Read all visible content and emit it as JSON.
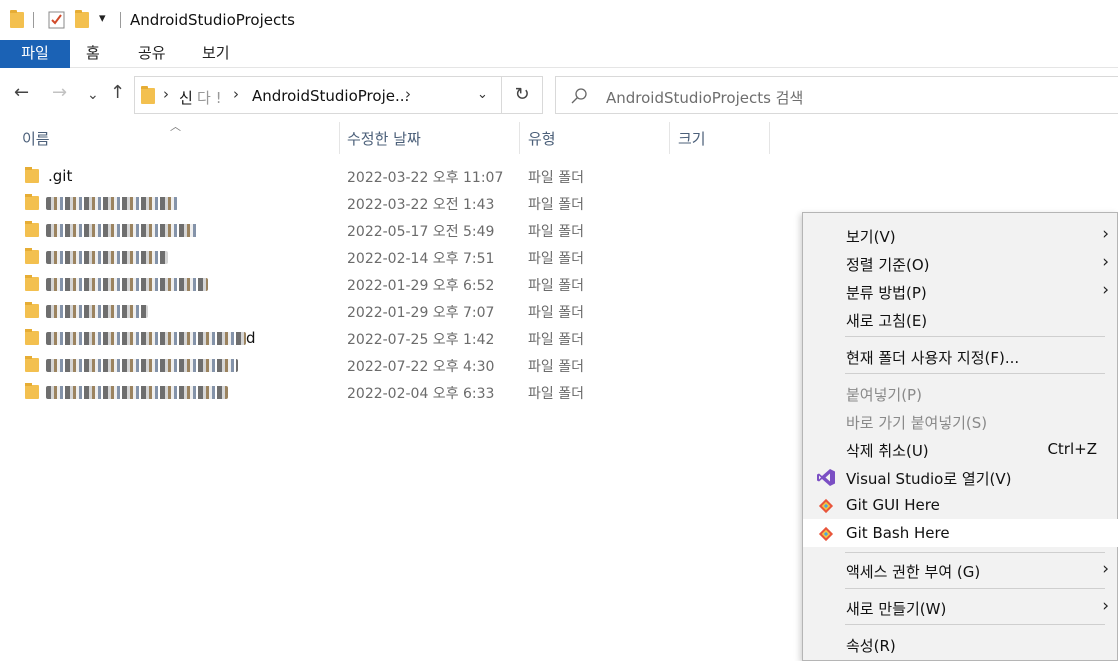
{
  "window": {
    "title": "AndroidStudioProjects",
    "quick_access_overflow": "▾"
  },
  "ribbon": {
    "tabs": [
      {
        "label": "파일",
        "active": true
      },
      {
        "label": "홈"
      },
      {
        "label": "공유"
      },
      {
        "label": "보기"
      }
    ]
  },
  "navigation": {
    "back": "←",
    "forward": "→",
    "recent": "⌄",
    "up": "↑",
    "breadcrumb": [
      "신",
      "AndroidStudioProje..."
    ],
    "breadcrumb_mid": "다 !",
    "refresh": "↻",
    "search_placeholder": "AndroidStudioProjects 검색"
  },
  "columns": {
    "name": "이름",
    "modified": "수정한 날짜",
    "type": "유형",
    "size": "크기"
  },
  "files": [
    {
      "name": ".git",
      "date": "2022-03-22 오후 11:07",
      "type": "파일 폴더",
      "blurred": false
    },
    {
      "name": "",
      "date": "2022-03-22 오전 1:43",
      "type": "파일 폴더",
      "blurred": true,
      "blur_w": 132
    },
    {
      "name": "",
      "date": "2022-05-17 오전 5:49",
      "type": "파일 폴더",
      "blurred": true,
      "blur_w": 152
    },
    {
      "name": "",
      "date": "2022-02-14 오후 7:51",
      "type": "파일 폴더",
      "blurred": true,
      "blur_w": 122
    },
    {
      "name": "",
      "date": "2022-01-29 오후 6:52",
      "type": "파일 폴더",
      "blurred": true,
      "blur_w": 162
    },
    {
      "name": "",
      "date": "2022-01-29 오후 7:07",
      "type": "파일 폴더",
      "blurred": true,
      "blur_w": 102
    },
    {
      "name": "d",
      "date": "2022-07-25 오후 1:42",
      "type": "파일 폴더",
      "blurred": true,
      "blur_w": 200
    },
    {
      "name": "",
      "date": "2022-07-22 오후 4:30",
      "type": "파일 폴더",
      "blurred": true,
      "blur_w": 192
    },
    {
      "name": "",
      "date": "2022-02-04 오후 6:33",
      "type": "파일 폴더",
      "blurred": true,
      "blur_w": 182
    }
  ],
  "context_menu": {
    "items": [
      {
        "label": "보기(V)",
        "submenu": true
      },
      {
        "label": "정렬 기준(O)",
        "submenu": true
      },
      {
        "label": "분류 방법(P)",
        "submenu": true
      },
      {
        "label": "새로 고침(E)"
      },
      {
        "label": "현재 폴더 사용자 지정(F)..."
      },
      {
        "label": "붙여넣기(P)",
        "disabled": true
      },
      {
        "label": "바로 가기 붙여넣기(S)",
        "disabled": true
      },
      {
        "label": "삭제 취소(U)",
        "shortcut": "Ctrl+Z"
      },
      {
        "label": "Visual Studio로 열기(V)",
        "icon": "visual-studio-icon"
      },
      {
        "label": "Git GUI Here",
        "icon": "git-icon"
      },
      {
        "label": "Git Bash Here",
        "icon": "git-icon",
        "hover": true
      },
      {
        "label": "액세스 권한 부여 (G)",
        "submenu": true
      },
      {
        "label": "새로 만들기(W)",
        "submenu": true
      },
      {
        "label": "속성(R)"
      }
    ]
  },
  "colors": {
    "file_tab": "#1b62b5",
    "folder": "#f3c04f",
    "menu_bg": "#f2f2f2"
  }
}
